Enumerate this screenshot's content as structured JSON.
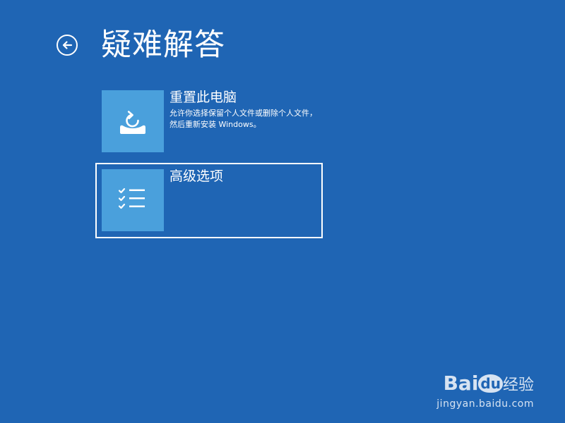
{
  "header": {
    "title": "疑难解答"
  },
  "options": [
    {
      "title": "重置此电脑",
      "description": "允许你选择保留个人文件或删除个人文件，然后重新安装 Windows。",
      "icon": "reset-pc-icon"
    },
    {
      "title": "高级选项",
      "description": "",
      "icon": "checklist-icon"
    }
  ],
  "watermark": {
    "brand_prefix": "Bai",
    "brand_mark": "du",
    "brand_suffix": "经验",
    "url": "jingyan.baidu.com"
  },
  "colors": {
    "background": "#1f65b4",
    "tile": "#4aa0dc",
    "text": "#ffffff"
  }
}
